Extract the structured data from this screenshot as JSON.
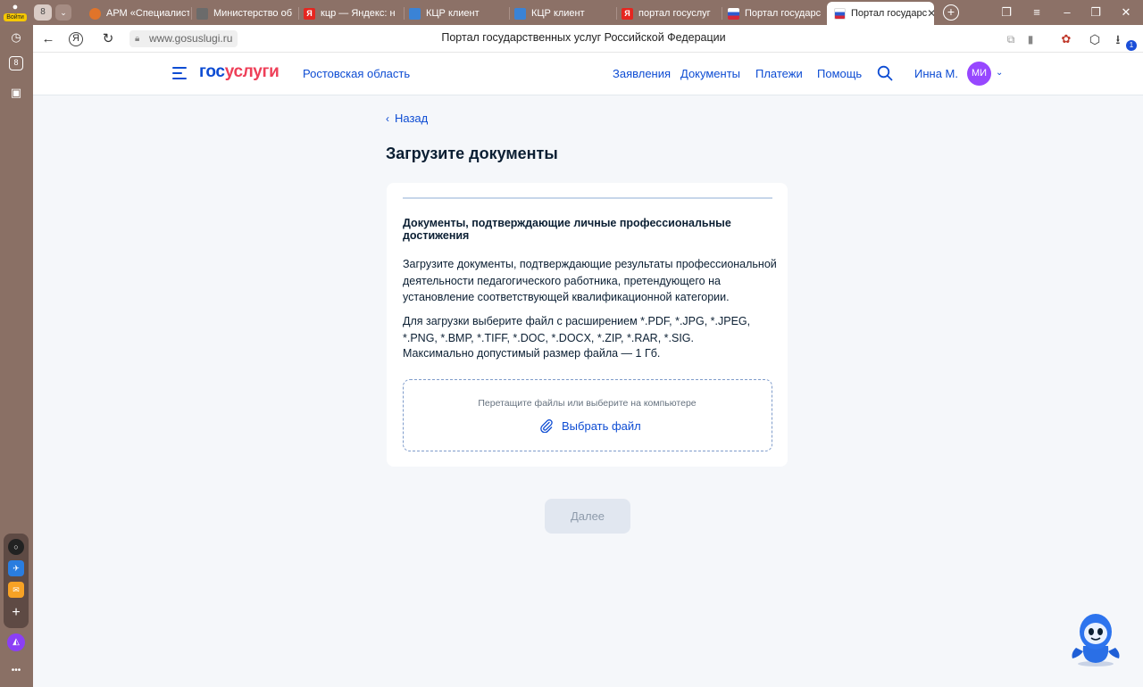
{
  "browser": {
    "login_label": "Войти",
    "tab_count": "8",
    "tabs": [
      {
        "title": "АРМ «Специалист",
        "icon_color": "#e0742a"
      },
      {
        "title": "Министерство об",
        "icon_color": "#6b6b6b"
      },
      {
        "title": "кцр — Яндекс: нац",
        "icon_color": "#e52620"
      },
      {
        "title": "КЦР клиент",
        "icon_color": "#3a83d6"
      },
      {
        "title": "КЦР клиент",
        "icon_color": "#3a83d6"
      },
      {
        "title": "портал госуслуг —",
        "icon_color": "#e52620"
      },
      {
        "title": "Портал государс",
        "icon_color": "#d6283a"
      },
      {
        "title": "Портал государс",
        "icon_color": "#d6283a"
      }
    ],
    "url": "www.gosuslugi.ru",
    "page_title": "Портал государственных услуг Российской Федерации",
    "download_count": "1"
  },
  "sidebar": {
    "count_badge": "8"
  },
  "header": {
    "logo_part1": "гос",
    "logo_part2": "услуги",
    "region": "Ростовская область",
    "nav": [
      "Заявления",
      "Документы",
      "Платежи",
      "Помощь"
    ],
    "user_name": "Инна М.",
    "avatar_initials": "МИ"
  },
  "main": {
    "back_label": "Назад",
    "heading": "Загрузите документы",
    "card": {
      "title": "Документы, подтверждающие личные профессиональные достижения",
      "description": "Загрузите документы, подтверждающие результаты профессиональной деятельности педагогического работника, претендующего на установление соответствующей квалификационной категории.",
      "formats": "Для загрузки выберите файл с расширением *.PDF, *.JPG, *.JPEG, *.PNG, *.BMP, *.TIFF, *.DOC, *.DOCX, *.ZIP, *.RAR, *.SIG.",
      "max_size": "Максимально допустимый размер файла — 1 Гб.",
      "drop_hint": "Перетащите файлы или выберите на компьютере",
      "choose_file_label": "Выбрать файл"
    },
    "next_label": "Далее"
  },
  "colors": {
    "brand_blue": "#0d4cd3",
    "brand_red": "#ee3f58",
    "avatar_bg": "#9747ff",
    "disabled_button": "#e1e7f0"
  }
}
